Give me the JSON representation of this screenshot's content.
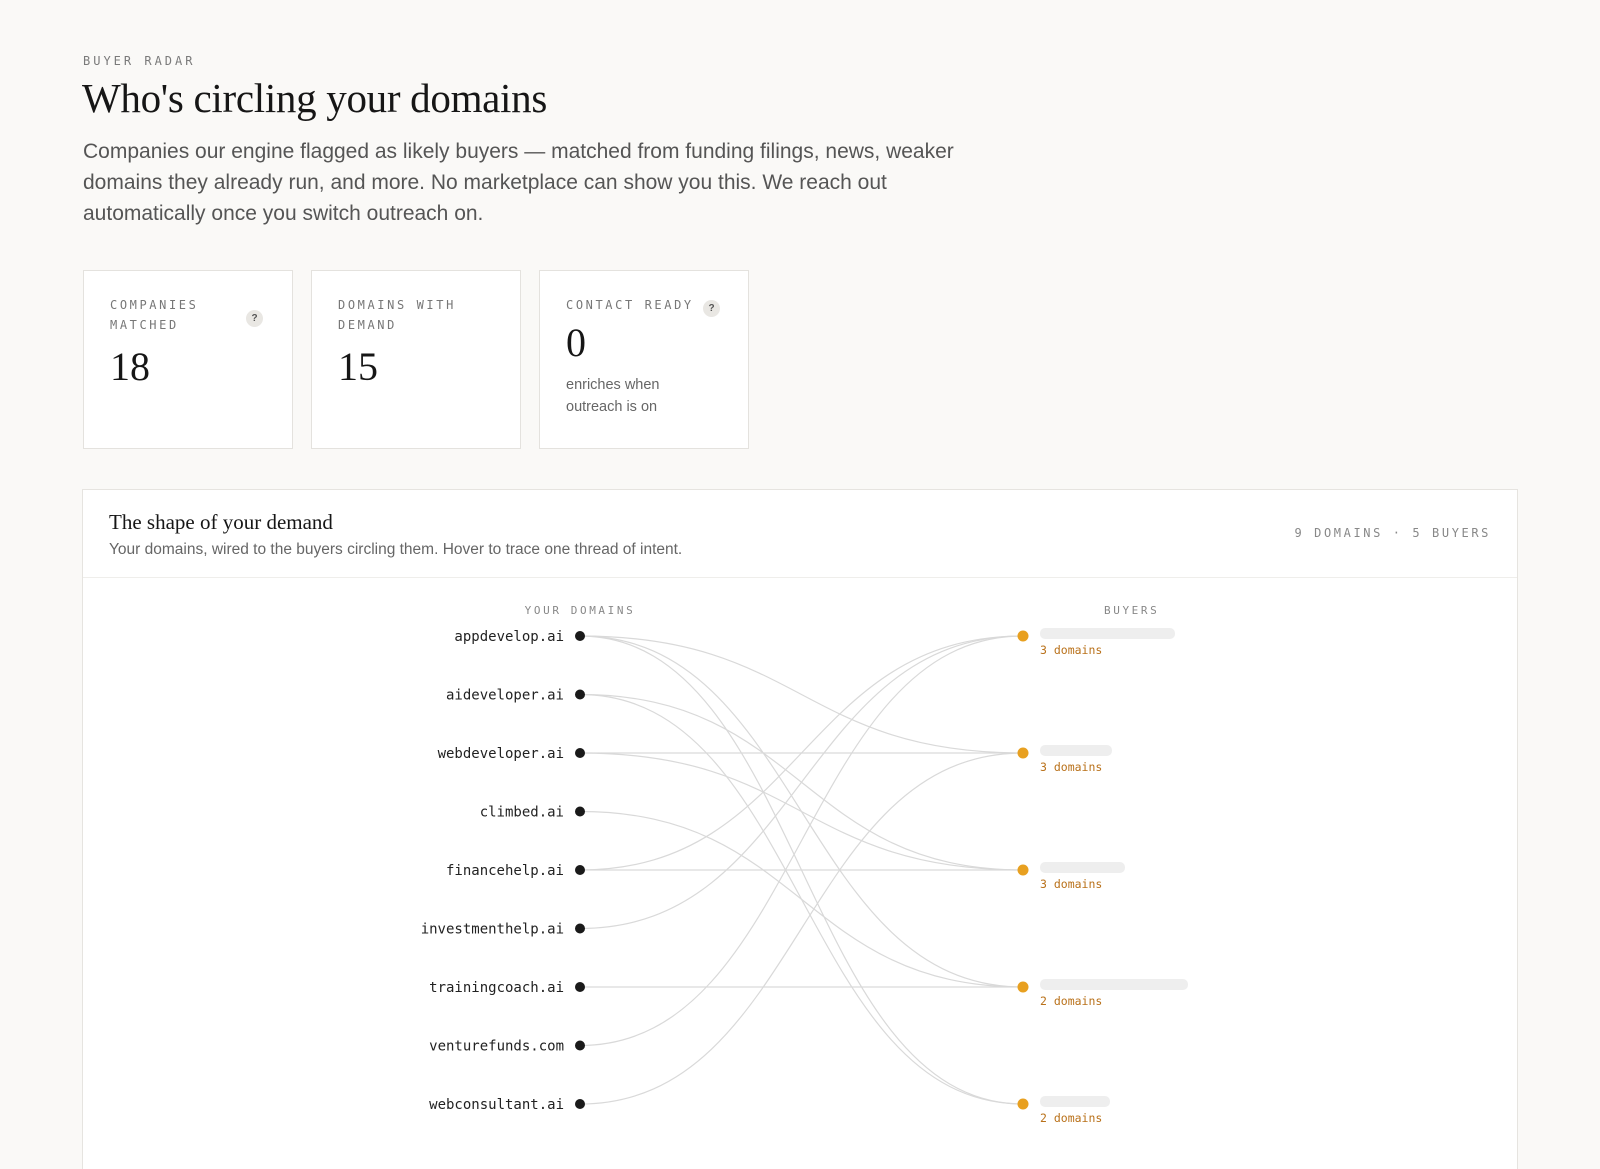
{
  "header": {
    "eyebrow": "BUYER RADAR",
    "title": "Who's circling your domains",
    "intro": "Companies our engine flagged as likely buyers — matched from funding filings, news, weaker domains they already run, and more. No marketplace can show you this. We reach out automatically once you switch outreach on."
  },
  "stats": [
    {
      "label": "COMPANIES MATCHED",
      "value": "18",
      "help": "?"
    },
    {
      "label": "DOMAINS WITH DEMAND",
      "value": "15"
    },
    {
      "label": "CONTACT READY",
      "value": "0",
      "help": "?",
      "note": "enriches when outreach is on"
    }
  ],
  "panel": {
    "title": "The shape of your demand",
    "subtitle": "Your domains, wired to the buyers circling them. Hover to trace one thread of intent.",
    "meta": "9 DOMAINS · 5 BUYERS",
    "domains_heading": "YOUR DOMAINS",
    "buyers_heading": "BUYERS"
  },
  "colors": {
    "domain_dot": "#1a1a1a",
    "buyer_dot": "#e8a020",
    "link": "#d9d9d9",
    "buyer_count": "#b9711a"
  },
  "domains": [
    "appdevelop.ai",
    "aideveloper.ai",
    "webdeveloper.ai",
    "climbed.ai",
    "financehelp.ai",
    "investmenthelp.ai",
    "trainingcoach.ai",
    "venturefunds.com",
    "webconsultant.ai"
  ],
  "buyers": [
    {
      "name_redacted": true,
      "count_label": "3 domains"
    },
    {
      "name_redacted": true,
      "count_label": "3 domains"
    },
    {
      "name_redacted": true,
      "count_label": "3 domains"
    },
    {
      "name_redacted": true,
      "count_label": "2 domains"
    },
    {
      "name_redacted": true,
      "count_label": "2 domains"
    }
  ],
  "links": [
    {
      "domain": 0,
      "buyer": 1
    },
    {
      "domain": 0,
      "buyer": 3
    },
    {
      "domain": 0,
      "buyer": 4
    },
    {
      "domain": 1,
      "buyer": 2
    },
    {
      "domain": 1,
      "buyer": 4
    },
    {
      "domain": 2,
      "buyer": 1
    },
    {
      "domain": 2,
      "buyer": 2
    },
    {
      "domain": 3,
      "buyer": 3
    },
    {
      "domain": 4,
      "buyer": 0
    },
    {
      "domain": 4,
      "buyer": 2
    },
    {
      "domain": 5,
      "buyer": 0
    },
    {
      "domain": 6,
      "buyer": 3
    },
    {
      "domain": 7,
      "buyer": 0
    },
    {
      "domain": 8,
      "buyer": 1
    }
  ]
}
